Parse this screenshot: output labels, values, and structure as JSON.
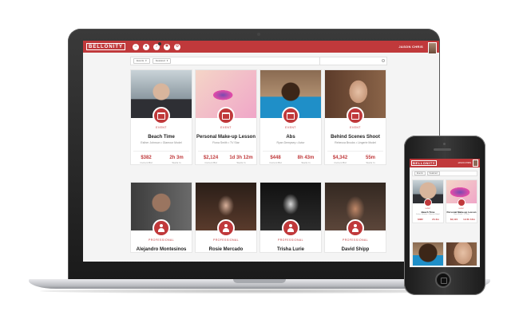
{
  "app": {
    "logo": "BELLONITY",
    "user_name": "JASON CHRIS",
    "header_icons": [
      "home-icon",
      "user-icon",
      "bell-icon",
      "settings-icon",
      "settings-icon"
    ],
    "accent_color": "#c0393b"
  },
  "filters": [
    {
      "label": "Events",
      "icon": "chevron-down-icon"
    },
    {
      "label": "Featured",
      "icon": "chevron-down-icon"
    }
  ],
  "search": {
    "placeholder": "",
    "icon": "search-icon"
  },
  "cards": [
    {
      "category": "EVENT",
      "icon": "calendar-icon",
      "title": "Beach Time",
      "subtitle": "Esther Johnson • Glamour Model",
      "stat1_value": "$382",
      "stat1_label": "Current Bid",
      "stat2_value": "2h 3m",
      "stat2_label": "Starts In"
    },
    {
      "category": "EVENT",
      "icon": "calendar-icon",
      "title": "Personal Make-up Lesson",
      "subtitle": "Fiona Smith • TV Star",
      "stat1_value": "$2,124",
      "stat1_label": "Current Bid",
      "stat2_value": "1d 3h 12m",
      "stat2_label": "Starts In"
    },
    {
      "category": "EVENT",
      "icon": "calendar-icon",
      "title": "Abs",
      "subtitle": "Ryan Dempsey • Actor",
      "stat1_value": "$448",
      "stat1_label": "Current Bid",
      "stat2_value": "8h 43m",
      "stat2_label": "Starts In"
    },
    {
      "category": "EVENT",
      "icon": "calendar-icon",
      "title": "Behind Scenes Shoot",
      "subtitle": "Rebecca Brooks • Lingerie Model",
      "stat1_value": "$4,342",
      "stat1_label": "Current Bid",
      "stat2_value": "55m",
      "stat2_label": "Starts In"
    },
    {
      "category": "PROFESSIONAL",
      "icon": "user-icon",
      "title": "Alejandro Montesinos",
      "subtitle": ""
    },
    {
      "category": "PROFESSIONAL",
      "icon": "user-icon",
      "title": "Rosie Mercado",
      "subtitle": ""
    },
    {
      "category": "PROFESSIONAL",
      "icon": "user-icon",
      "title": "Trisha Lurie",
      "subtitle": ""
    },
    {
      "category": "PROFESSIONAL",
      "icon": "user-icon",
      "title": "David Shipp",
      "subtitle": ""
    }
  ],
  "mobile": {
    "logo": "BELLONITY",
    "user_name": "JASON CHRIS",
    "filters": [
      "Events",
      "Featured"
    ],
    "cards": [
      {
        "category": "EVENT",
        "title": "Beach Time",
        "subtitle": "Esther Johnson • Glamour Model",
        "stat1_value": "$382",
        "stat2_value": "2h 3m"
      },
      {
        "category": "EVENT",
        "title": "Personal Make-up Lesson",
        "subtitle": "Fiona Smith • TV Star",
        "stat1_value": "$2,124",
        "stat2_value": "1d 3h 12m"
      }
    ]
  }
}
